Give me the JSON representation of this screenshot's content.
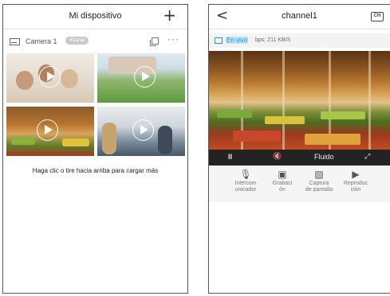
{
  "left_screen": {
    "header_title": "Mi dispositivo",
    "add_symbol": "+",
    "camera": {
      "name": "Camera 1",
      "badge": "4Canal",
      "more": "···"
    },
    "load_more_text": "Haga clic o tire hacia arriba para cargar más"
  },
  "right_screen": {
    "header_title": "channel1",
    "back_symbol": "<",
    "channel_icon_text": "CH",
    "live_label": "En vivo",
    "bps_text": "bps: 211 KB/S",
    "controls": {
      "pause": "II",
      "mute": "🔇",
      "quality": "Fluido",
      "fullscreen": "⤢"
    },
    "tools": [
      {
        "icon": "microphone-icon",
        "glyph": "🎙",
        "label": "Intercom\nunicador"
      },
      {
        "icon": "record-icon",
        "glyph": "▣",
        "label": "Grabaci\nón"
      },
      {
        "icon": "screenshot-icon",
        "glyph": "▨",
        "label": "Captura\nde pantalla"
      },
      {
        "icon": "playback-icon",
        "glyph": "▶",
        "label": "Reproduc\nción"
      }
    ]
  },
  "colors": {
    "accent": "#1a9ad6",
    "control_bar": "#232323"
  }
}
